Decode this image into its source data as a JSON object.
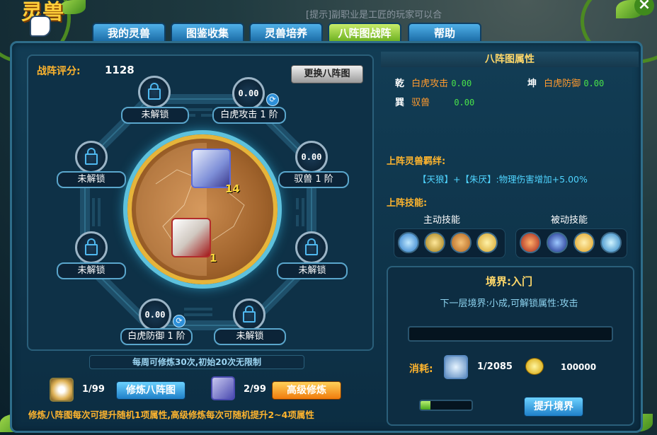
{
  "top_logo": "灵兽",
  "notice_text": "[提示]副职业是工匠的玩家可以合",
  "tabs": [
    {
      "label": "我的灵兽"
    },
    {
      "label": "图鉴收集"
    },
    {
      "label": "灵兽培养"
    },
    {
      "label": "八阵图战阵"
    },
    {
      "label": "帮助"
    }
  ],
  "formation": {
    "score_label": "战阵评分:",
    "score_value": "1128",
    "swap_button": "更换八阵图",
    "slots": [
      {
        "value": "",
        "label": "未解锁",
        "locked": true
      },
      {
        "value": "0.00",
        "label": "白虎攻击 1 阶",
        "locked": false
      },
      {
        "value": "",
        "label": "未解锁",
        "locked": true
      },
      {
        "value": "0.00",
        "label": "驭兽 1 阶",
        "locked": false
      },
      {
        "value": "",
        "label": "未解锁",
        "locked": true
      },
      {
        "value": "",
        "label": "未解锁",
        "locked": true
      },
      {
        "value": "0.00",
        "label": "白虎防御 1 阶",
        "locked": false
      },
      {
        "value": "",
        "label": "未解锁",
        "locked": true
      }
    ],
    "pets": [
      {
        "count": "14"
      },
      {
        "count": "1"
      }
    ],
    "weekly_notice": "每周可修炼30次,初始20次无限制",
    "train": {
      "count": "1/99",
      "button": "修炼八阵图"
    },
    "advanced": {
      "count": "2/99",
      "button": "高级修炼"
    },
    "tip": "修炼八阵图每次可提升随机1项属性,高级修炼每次可随机提升2~4项属性"
  },
  "attributes": {
    "header": "八阵图属性",
    "items": [
      {
        "gua": "乾",
        "name": "白虎攻击",
        "value": "0.00"
      },
      {
        "gua": "坤",
        "name": "白虎防御",
        "value": "0.00"
      },
      {
        "gua": "巽",
        "name": "驭兽",
        "value": "0.00"
      }
    ],
    "bond_title": "上阵灵兽羁绊:",
    "bond_text": "【天狼】+【朱厌】:物理伤害增加+5.00%",
    "skills_title": "上阵技能:",
    "active_label": "主动技能",
    "passive_label": "被动技能",
    "active_skills": [
      "lightning-skill-icon",
      "claw-skill-icon",
      "rock-skill-icon",
      "slash-skill-icon"
    ],
    "passive_skills": [
      "fire-skill-icon",
      "shadow-skill-icon",
      "moon-skill-icon",
      "cross-skill-icon"
    ]
  },
  "realm": {
    "title": "境界:入门",
    "next": "下一层境界:小成,可解锁属性:攻击",
    "progress": 0.0,
    "cost_label": "消耗:",
    "cost_item_count": "1/2085",
    "cost_gold": "100000",
    "small_progress": 0.2,
    "button": "提升境界"
  },
  "colors": {
    "accent_orange": "#ffb52e",
    "value_green": "#49e24a",
    "tab_active": "#6fb222",
    "tab_normal": "#1d6ea8"
  }
}
